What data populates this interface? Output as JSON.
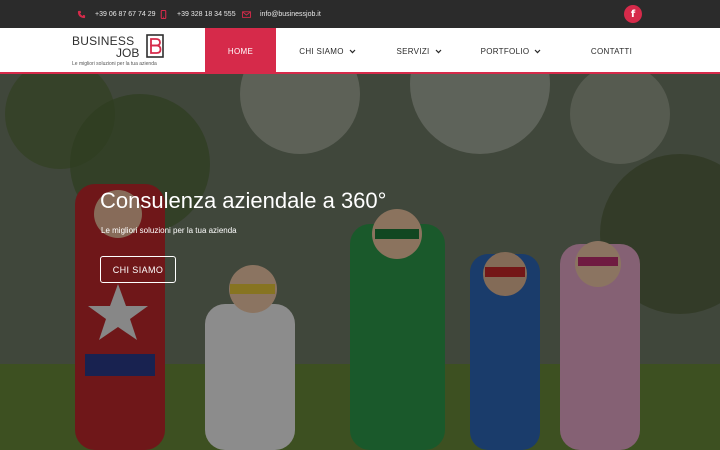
{
  "topbar": {
    "phone1": "+39 06 87 67 74 29",
    "phone2": "+39 328 18 34 555",
    "email": "info@businessjob.it",
    "facebook_glyph": "f",
    "accent": "#d62a4a",
    "icons": [
      "phone-icon",
      "mobile-icon",
      "envelope-icon",
      "facebook-icon"
    ]
  },
  "header": {
    "logo_line1": "BUSINESS",
    "logo_line2": "JOB",
    "logo_tagline": "Le migliori soluzioni per la tua azienda",
    "nav": [
      {
        "label": "HOME",
        "dropdown": false,
        "active": true
      },
      {
        "label": "CHI SIAMO",
        "dropdown": true
      },
      {
        "label": "SERVIZI",
        "dropdown": true
      },
      {
        "label": "PORTFOLIO",
        "dropdown": true
      },
      {
        "label": "CONTATTI",
        "dropdown": false
      }
    ],
    "chevron": "⌄"
  },
  "hero": {
    "title": "Consulenza aziendale a 360°",
    "subtitle": "Le migliori soluzioni per la tua azienda",
    "button_label": "CHI SIAMO"
  }
}
